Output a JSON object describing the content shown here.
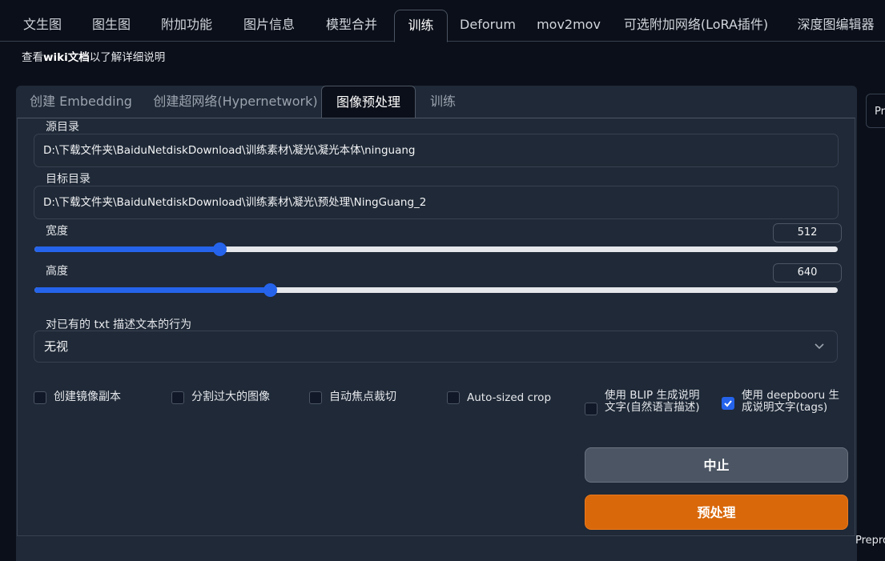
{
  "top_tabs": [
    {
      "label": "文生图"
    },
    {
      "label": "图生图"
    },
    {
      "label": "附加功能"
    },
    {
      "label": "图片信息"
    },
    {
      "label": "模型合并"
    },
    {
      "label": "训练",
      "active": true
    },
    {
      "label": "Deforum"
    },
    {
      "label": "mov2mov"
    },
    {
      "label": "可选附加网络(LoRA插件)"
    },
    {
      "label": "深度图编辑器"
    }
  ],
  "wiki": {
    "prefix": "查看",
    "link": "wiki文档",
    "suffix": "以了解详细说明"
  },
  "sub_tabs": [
    {
      "label": "创建 Embedding"
    },
    {
      "label": "创建超网络(Hypernetwork)"
    },
    {
      "label": "图像预处理",
      "active": true
    },
    {
      "label": "训练"
    }
  ],
  "form": {
    "source_label": "源目录",
    "source_value": "D:\\下载文件夹\\BaiduNetdiskDownload\\训练素材\\凝光\\凝光本体\\ninguang",
    "target_label": "目标目录",
    "target_value": "D:\\下载文件夹\\BaiduNetdiskDownload\\训练素材\\凝光\\预处理\\NingGuang_2",
    "width_label": "宽度",
    "width_value": "512",
    "width_fraction": 0.23,
    "height_label": "高度",
    "height_value": "640",
    "height_fraction": 0.293,
    "txt_action_label": "对已有的 txt 描述文本的行为",
    "txt_action_value": "无视"
  },
  "checkboxes": [
    {
      "label": "创建镜像副本",
      "checked": false
    },
    {
      "label": "分割过大的图像",
      "checked": false
    },
    {
      "label": "自动焦点裁切",
      "checked": false
    },
    {
      "label": "Auto-sized crop",
      "checked": false
    },
    {
      "label": "使用 BLIP 生成说明文字(自然语言描述)",
      "checked": false
    },
    {
      "label": "使用 deepbooru 生成说明文字(tags)",
      "checked": true
    }
  ],
  "buttons": {
    "stop": "中止",
    "preprocess": "预处理"
  },
  "right_panel": {
    "box_text": "Pr",
    "bottom_text": "Prepro"
  },
  "colors": {
    "accent": "#2563eb",
    "primary_button": "#d9680a",
    "background": "#0b0f19",
    "panel": "#1f2937"
  }
}
